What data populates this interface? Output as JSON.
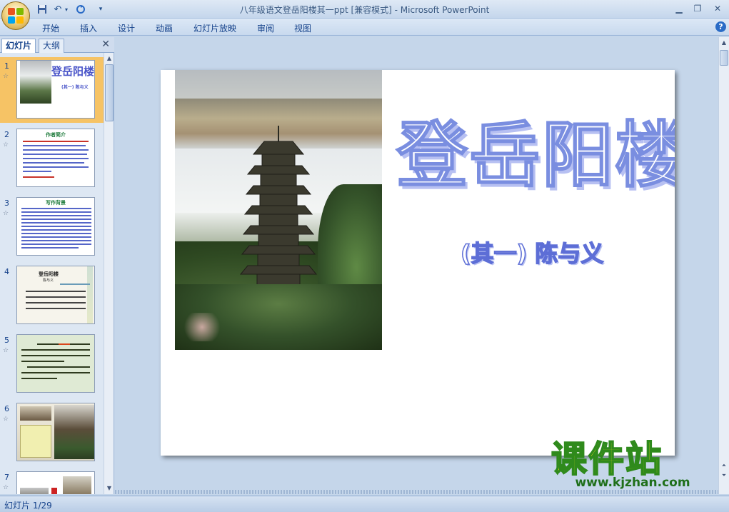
{
  "window": {
    "title": "八年级语文登岳阳楼其一ppt [兼容模式] - Microsoft PowerPoint"
  },
  "ribbon": {
    "tabs": [
      "开始",
      "插入",
      "设计",
      "动画",
      "幻灯片放映",
      "审阅",
      "视图"
    ]
  },
  "left_panel": {
    "tabs": [
      "幻灯片",
      "大纲"
    ],
    "slides": [
      {
        "num": "1",
        "thumb_title": "登岳阳楼",
        "thumb_sub": "(其一) 陈与义"
      },
      {
        "num": "2",
        "thumb_title": "作者简介"
      },
      {
        "num": "3",
        "thumb_title": "写作背景"
      },
      {
        "num": "4",
        "thumb_title": "登岳阳楼",
        "thumb_sub": "陈与义"
      },
      {
        "num": "5"
      },
      {
        "num": "6"
      },
      {
        "num": "7"
      }
    ]
  },
  "slide": {
    "title": "登岳阳楼",
    "subtitle": "(其一) 陈与义"
  },
  "watermark": {
    "text": "课件站",
    "url": "www.kjzhan.com"
  },
  "status": {
    "slide_indicator": "幻灯片 1/29"
  }
}
